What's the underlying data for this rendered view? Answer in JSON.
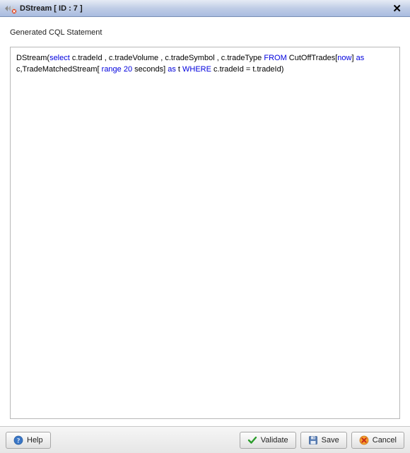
{
  "titlebar": {
    "title": "DStream [ ID : 7 ]"
  },
  "section": {
    "label": "Generated CQL Statement"
  },
  "cql": {
    "tokens": [
      {
        "t": "DStream(",
        "c": "id"
      },
      {
        "t": "select",
        "c": "kw"
      },
      {
        "t": " c.tradeId , c.tradeVolume , c.tradeSymbol , c.tradeType ",
        "c": "id"
      },
      {
        "t": " FROM",
        "c": "kw"
      },
      {
        "t": " CutOffTrades[",
        "c": "id"
      },
      {
        "t": "now",
        "c": "kw"
      },
      {
        "t": "] ",
        "c": "id"
      },
      {
        "t": "as",
        "c": "kw"
      },
      {
        "t": " c,TradeMatchedStream[",
        "c": "id"
      },
      {
        "t": " range 20",
        "c": "kw"
      },
      {
        "t": " seconds] ",
        "c": "id"
      },
      {
        "t": "as",
        "c": "kw"
      },
      {
        "t": " t ",
        "c": "id"
      },
      {
        "t": "WHERE",
        "c": "kw"
      },
      {
        "t": "  c.tradeId  =  t.tradeId)",
        "c": "id"
      }
    ]
  },
  "buttons": {
    "help": "Help",
    "validate": "Validate",
    "save": "Save",
    "cancel": "Cancel"
  }
}
